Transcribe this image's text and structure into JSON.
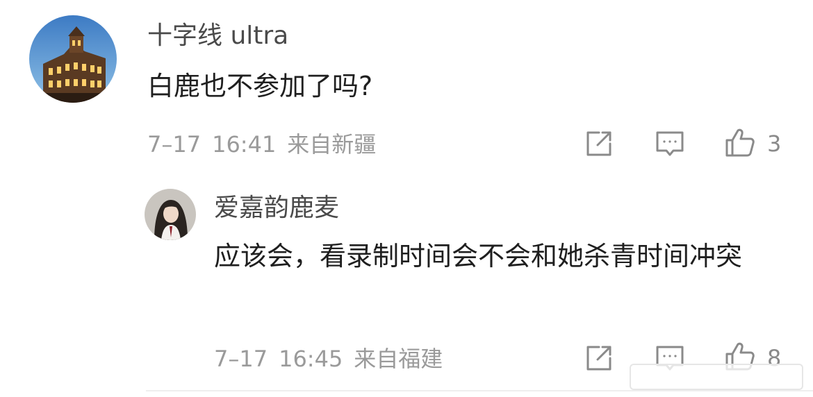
{
  "comment": {
    "username": "十字线 ultra",
    "text": "白鹿也不参加了吗?",
    "date": "7–17",
    "time": "16:41",
    "location": "来自新疆",
    "like_count": "3",
    "avatar_icon": "building-avatar"
  },
  "reply": {
    "username": "爱嘉韵鹿麦",
    "text": "应该会，看录制时间会不会和她杀青时间冲突",
    "date": "7–17",
    "time": "16:45",
    "location": "来自福建",
    "like_count": "8",
    "avatar_icon": "girl-avatar"
  },
  "icons": {
    "share": "share-icon",
    "comment": "comment-icon",
    "like": "thumbs-up-icon"
  },
  "colors": {
    "text_primary": "#1f1f1f",
    "text_name": "#4a4a4a",
    "text_meta": "#9a9a9a",
    "icon_stroke": "#8a8a8a"
  }
}
